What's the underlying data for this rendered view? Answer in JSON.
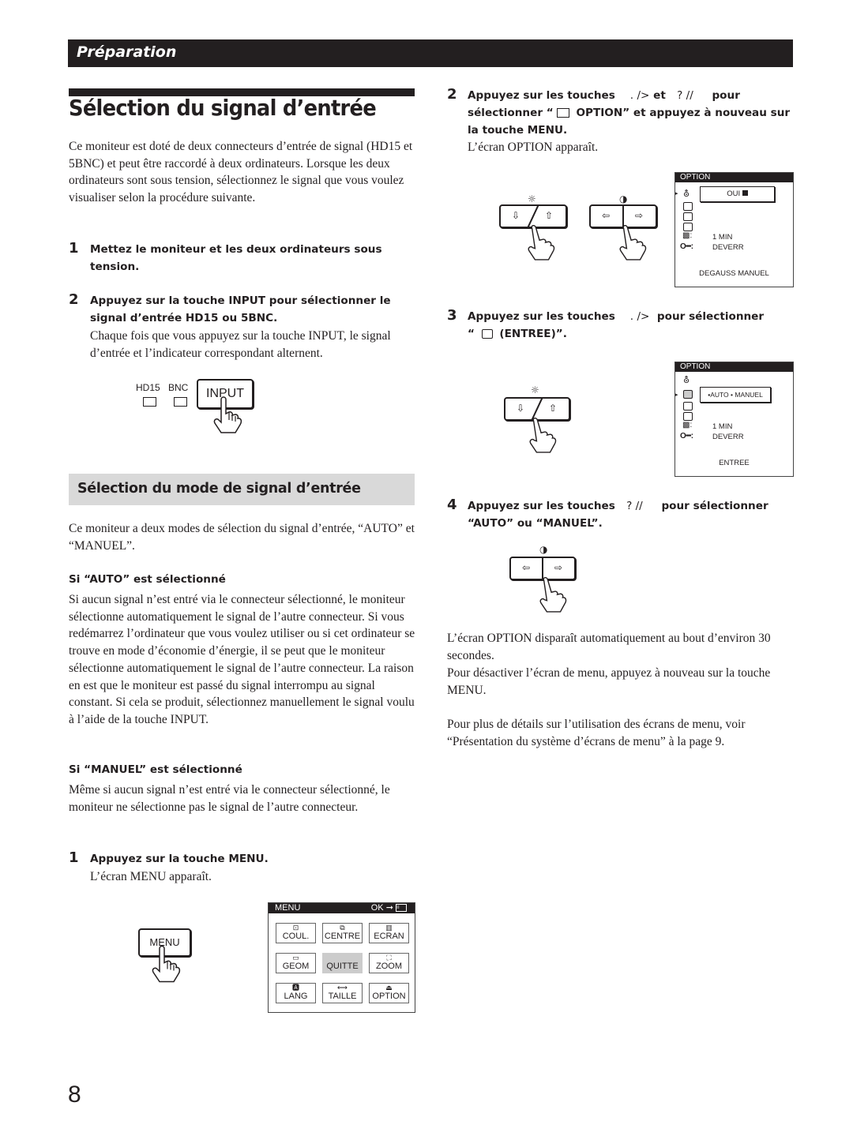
{
  "header": {
    "section": "Préparation"
  },
  "page_title": "Sélection du signal d’entrée",
  "intro": "Ce moniteur est doté de deux connecteurs d’entrée de signal (HD15 et 5BNC) et peut être raccordé à deux ordinateurs. Lorsque les deux ordinateurs sont sous tension, sélectionnez le signal que vous voulez visualiser selon la procédure suivante.",
  "left_steps": [
    {
      "num": "1",
      "text": "Mettez le moniteur et les deux ordinateurs sous tension.",
      "note": ""
    },
    {
      "num": "2",
      "text": "Appuyez sur la touche INPUT pour sélectionner le signal d’entrée HD15 ou 5BNC.",
      "note": "Chaque fois que vous appuyez sur la touche INPUT, le signal d’entrée et l’indicateur correspondant alternent."
    }
  ],
  "input_figure": {
    "indicator_1": "HD15",
    "indicator_2": "BNC",
    "button": "INPUT"
  },
  "section2": {
    "title": "Sélection du mode de signal d’entrée",
    "intro": "Ce moniteur a deux modes de sélection du signal d’entrée, “AUTO” et “MANUEL”.",
    "auto_heading": "Si “AUTO” est sélectionné",
    "auto_text": "Si aucun signal n’est entré via le connecteur sélectionné, le moniteur sélectionne automatiquement le signal de l’autre connecteur. Si vous redémarrez l’ordinateur que vous voulez utiliser ou si cet ordinateur se trouve en mode d’économie d’énergie, il se peut que le moniteur sélectionne automatiquement le signal de l’autre connecteur. La raison en est que le moniteur est passé du signal interrompu au signal constant. Si cela se produit, sélectionnez manuellement le signal voulu à l’aide de la touche INPUT.",
    "manuel_heading": "Si “MANUEL” est sélectionné",
    "manuel_text": "Même si aucun signal n’est entré via le connecteur sélectionné, le moniteur ne sélectionne pas le signal de l’autre connecteur.",
    "step1": {
      "num": "1",
      "text": "Appuyez sur la touche MENU.",
      "note": "L’écran MENU apparaît."
    }
  },
  "menu_figure": {
    "button": "MENU",
    "osd_title": "MENU",
    "osd_ok": "OK",
    "items": [
      {
        "label": "COUL.",
        "icon": "color-icon"
      },
      {
        "label": "CENTRE",
        "icon": "center-icon"
      },
      {
        "label": "ECRAN",
        "icon": "screen-icon"
      },
      {
        "label": "GEOM",
        "icon": "geometry-icon"
      },
      {
        "label": "QUITTE",
        "icon": "exit-icon",
        "selected": true
      },
      {
        "label": "ZOOM",
        "icon": "zoom-icon"
      },
      {
        "label": "LANG",
        "icon": "language-icon"
      },
      {
        "label": "TAILLE",
        "icon": "size-icon"
      },
      {
        "label": "OPTION",
        "icon": "option-icon"
      }
    ]
  },
  "right_steps": {
    "step2": {
      "num": "2",
      "l1a": "Appuyez sur les touches",
      "l1b": ". />",
      "l1c": "et",
      "l1d": "?  //",
      "l1e": "pour",
      "l2a": "sélectionner “",
      "l2b": "OPTION” et appuyez à nouveau sur",
      "l3": "la touche MENU.",
      "note": "L’écran OPTION apparaît."
    },
    "step3": {
      "num": "3",
      "l1a": "Appuyez sur les touches",
      "l1b": ". />",
      "l1c": "pour sélectionner",
      "l2a": "“",
      "l2b": "(ENTREE)”."
    },
    "step4": {
      "num": "4",
      "l1a": "Appuyez sur les touches",
      "l1b": "?  //",
      "l1c": "pour sélectionner",
      "l2": "“AUTO” ou “MANUEL”."
    }
  },
  "option_osd_1": {
    "title": "OPTION",
    "popup": "OUI",
    "row_timer": "1 MIN",
    "row_lock": "DEVERR",
    "footer": "DEGAUSS MANUEL"
  },
  "option_osd_2": {
    "title": "OPTION",
    "popup_auto": "AUTO",
    "popup_manuel": "MANUEL",
    "row_timer": "1 MIN",
    "row_lock": "DEVERR",
    "footer": "ENTREE"
  },
  "closing": {
    "p1": "L’écran OPTION disparaît automatiquement au bout d’environ 30 secondes.",
    "p2": "Pour désactiver l’écran de menu, appuyez à nouveau sur la touche MENU.",
    "p3": "Pour plus de détails sur l’utilisation des écrans de menu, voir “Présentation du système d’écrans de menu” à la page 9."
  },
  "page_number": "8"
}
